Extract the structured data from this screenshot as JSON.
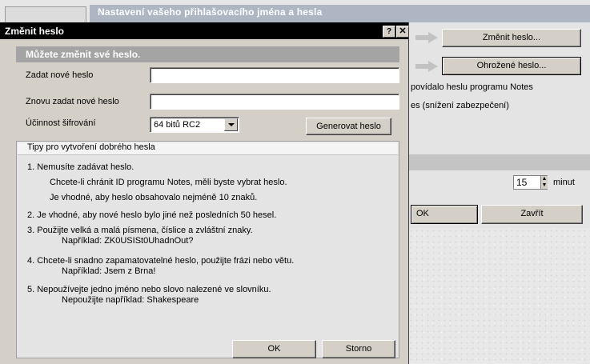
{
  "background": {
    "title": "Nastavení vašeho přihlašovacího jména a hesla",
    "buttons": {
      "change_password": "Změnit heslo...",
      "compromised_password": "Ohrožené heslo...",
      "ok": "OK",
      "close": "Zavřít"
    },
    "fragments": {
      "rules_text": "povídalo heslu programu Notes",
      "reduced_security": "es (snížení zabezpečení)"
    },
    "timeout": {
      "value": "15",
      "unit": "minut"
    }
  },
  "dialog": {
    "title": "Změnit heslo",
    "help_glyph": "?",
    "close_glyph": "✕",
    "subtitle": "Můžete změnit své heslo.",
    "labels": {
      "new_password": "Zadat nové heslo",
      "confirm_password": "Znovu zadat nové heslo",
      "encryption_strength": "Účinnost šifrování"
    },
    "encryption_value": "64 bitů RC2",
    "generate_button": "Generovat heslo",
    "tips": {
      "header": "Tipy pro vytvoření dobrého hesla",
      "t1": "1.  Nemusíte zadávat heslo.",
      "t1a": "Chcete-li chránit ID programu Notes, měli byste vybrat heslo.",
      "t1b": "Je vhodné, aby heslo obsahovalo nejméně 10 znaků.",
      "t2": "2.  Je vhodné, aby nové heslo bylo jiné než posledních 50 hesel.",
      "t3": "3.  Použijte velká a malá písmena, číslice a zvláštní znaky.",
      "t3a": "Například:  ZK0USISt0UhadnOut?",
      "t4": "4.  Chcete-li snadno zapamatovatelné heslo, použijte frázi nebo větu.",
      "t4a": "Například:  Jsem z Brna!",
      "t5": "5.  Nepoužívejte jedno jméno nebo slovo nalezené ve slovníku.",
      "t5a": "Nepoužijte například:  Shakespeare"
    },
    "ok_button": "OK",
    "cancel_button": "Storno"
  }
}
